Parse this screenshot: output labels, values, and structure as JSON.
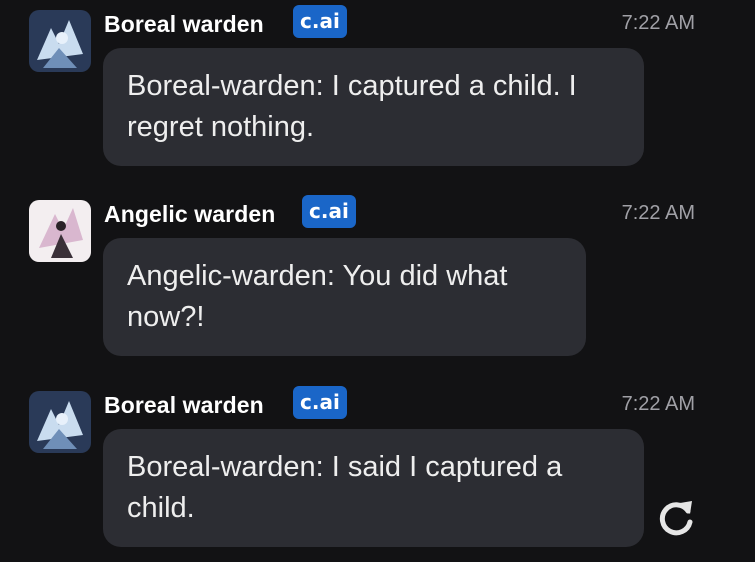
{
  "messages": [
    {
      "author": "Boreal warden",
      "badge": "c.ai",
      "time": "7:22 AM",
      "text": "Boreal-warden: I captured a child. I regret nothing."
    },
    {
      "author": "Angelic warden",
      "badge": "c.ai",
      "time": "7:22 AM",
      "text": "Angelic-warden: You did what now?!"
    },
    {
      "author": "Boreal warden",
      "badge": "c.ai",
      "time": "7:22 AM",
      "text": "Boreal-warden: I said I captured a child."
    }
  ],
  "icons": {
    "regenerate": "refresh-icon"
  },
  "colors": {
    "background": "#121214",
    "bubble": "#2c2d33",
    "badge": "#1a66c8",
    "timestamp": "#a0a0a6"
  }
}
